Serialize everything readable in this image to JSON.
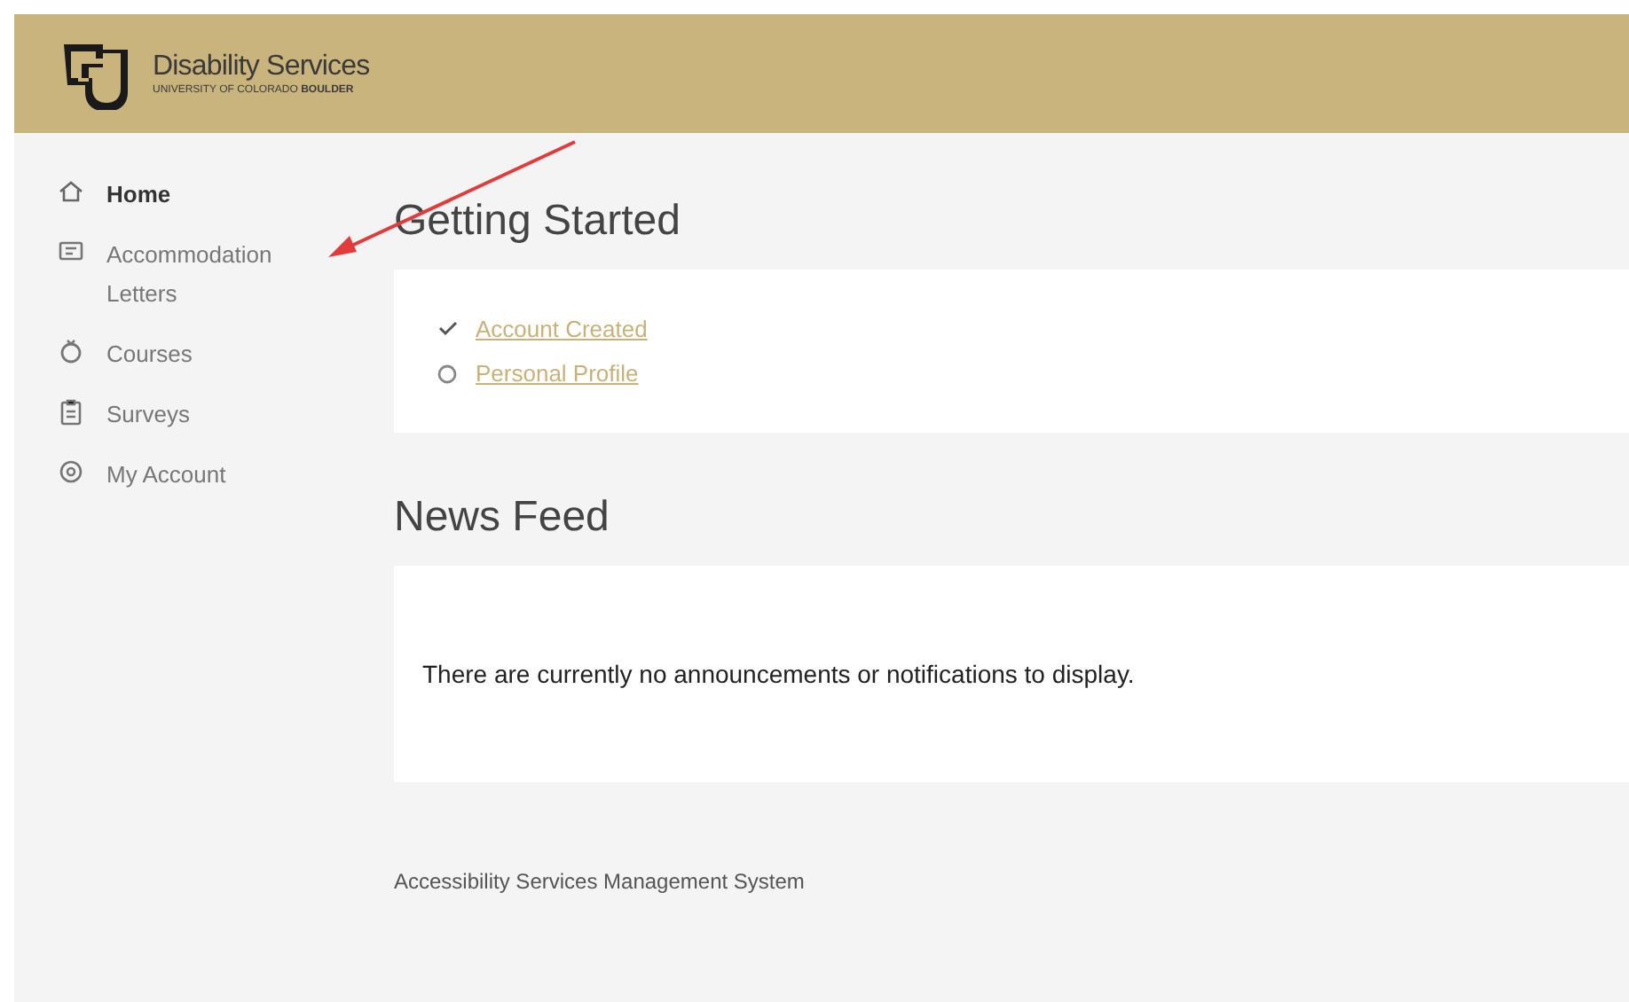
{
  "header": {
    "title": "Disability Services",
    "subtitle_regular": "UNIVERSITY OF COLORADO",
    "subtitle_bold": "BOULDER"
  },
  "sidebar": {
    "items": [
      {
        "label": "Home",
        "selected": true
      },
      {
        "label": "Accommodation Letters",
        "selected": false
      },
      {
        "label": "Courses",
        "selected": false
      },
      {
        "label": "Surveys",
        "selected": false
      },
      {
        "label": "My Account",
        "selected": false
      }
    ]
  },
  "getting_started": {
    "title": "Getting Started",
    "steps": [
      {
        "label": "Account Created",
        "done": true
      },
      {
        "label": "Personal Profile",
        "done": false
      }
    ]
  },
  "news_feed": {
    "title": "News Feed",
    "message": "There are currently no announcements or notifications to display."
  },
  "footer": "Accessibility Services Management System"
}
